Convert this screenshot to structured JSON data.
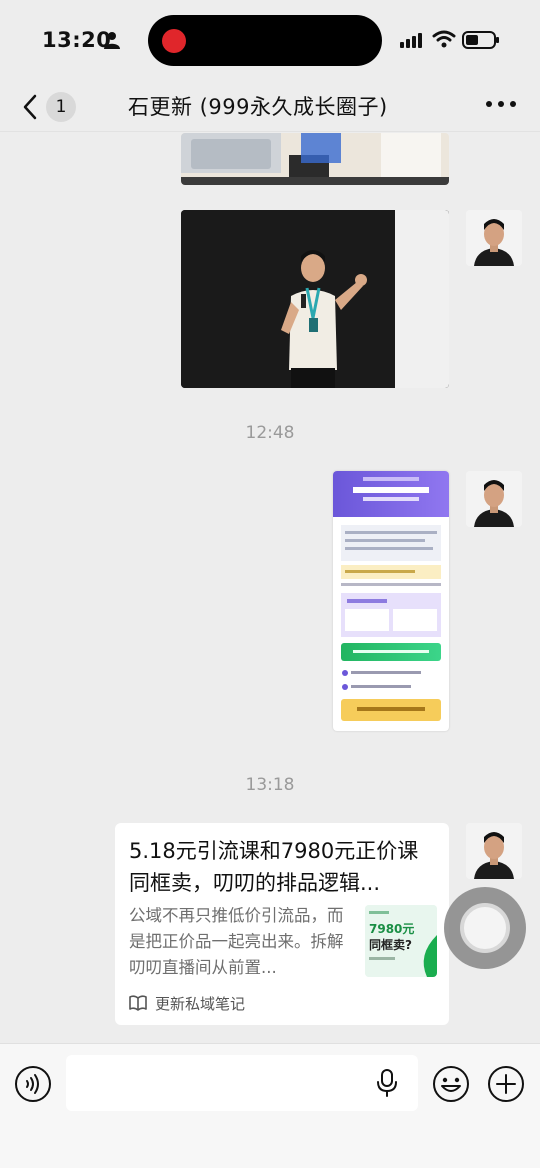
{
  "status_bar": {
    "time": "13:20"
  },
  "nav": {
    "unread_count": "1",
    "title": "石更新 (999永久成长圈子)"
  },
  "messages": {
    "timestamp_1": "12:48",
    "timestamp_2": "13:18",
    "link_card": {
      "title": "5.18元引流课和7980元正价课同框卖，叨叨的排品逻辑...",
      "description": "公域不再只推低价引流品，而是把正价品一起亮出来。拆解叨叨直播间从前置...",
      "thumb_price": "7980元",
      "thumb_text": "同框卖?",
      "source": "更新私域笔记"
    }
  },
  "colors": {
    "background": "#ededed",
    "card": "#ffffff",
    "timestamp": "#9a9a9a",
    "accent_green": "#1aad4f"
  },
  "icons": [
    "person-icon",
    "signal-icon",
    "wifi-icon",
    "battery-icon",
    "back-chevron-icon",
    "more-icon",
    "book-icon",
    "voice-icon",
    "mic-icon",
    "emoji-icon",
    "plus-icon"
  ]
}
